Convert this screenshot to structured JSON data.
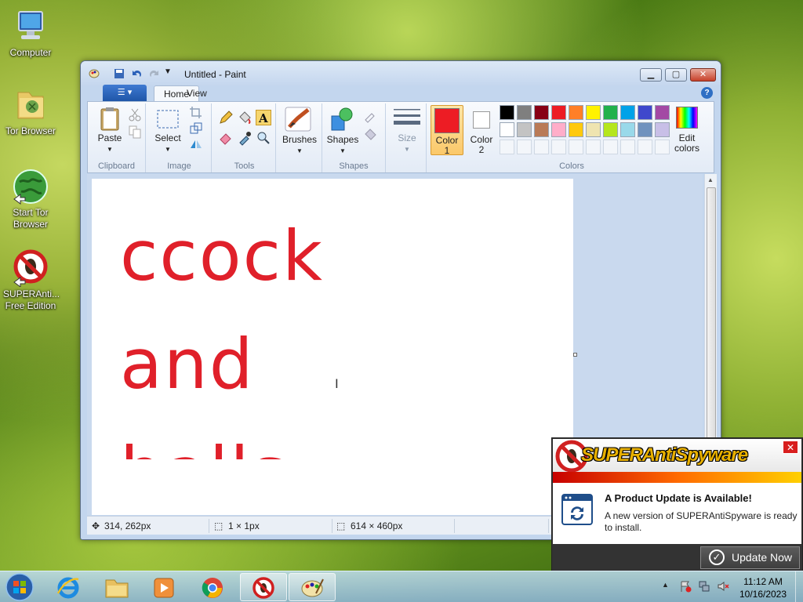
{
  "desktop": {
    "icons": [
      {
        "label": "Computer"
      },
      {
        "label": "Tor Browser"
      },
      {
        "label": "Start Tor Browser"
      },
      {
        "label": "SUPERAnti... Free Edition"
      }
    ]
  },
  "paint": {
    "title": "Untitled - Paint",
    "file_menu": "☰",
    "tabs": {
      "home": "Home",
      "view": "View"
    },
    "groups": {
      "clipboard": "Clipboard",
      "image": "Image",
      "tools": "Tools",
      "shapes": "Shapes",
      "colors": "Colors"
    },
    "buttons": {
      "paste": "Paste",
      "select": "Select",
      "brushes": "Brushes",
      "shapes": "Shapes",
      "size": "Size",
      "color1_line1": "Color",
      "color1_line2": "1",
      "color2_line1": "Color",
      "color2_line2": "2",
      "edit_colors_line1": "Edit",
      "edit_colors_line2": "colors"
    },
    "selected_colors": {
      "color1": "#ed1c24",
      "color2": "#ffffff"
    },
    "palette_row1": [
      "#000000",
      "#7f7f7f",
      "#880015",
      "#ed1c24",
      "#ff7f27",
      "#fff200",
      "#22b14c",
      "#00a2e8",
      "#3f48cc",
      "#a349a4"
    ],
    "palette_row2": [
      "#ffffff",
      "#c3c3c3",
      "#b97a57",
      "#ffaec9",
      "#ffc90e",
      "#efe4b0",
      "#b5e61d",
      "#99d9ea",
      "#7092be",
      "#c8bfe7"
    ],
    "canvas_words": [
      "ccock",
      "and",
      "balls"
    ],
    "status": {
      "cursor": "314, 262px",
      "selection": "1 × 1px",
      "image_size": "614 × 460px"
    }
  },
  "notification": {
    "brand": "SUPERAntiSpyware",
    "close_label": "✕",
    "heading": "A Product Update is Available!",
    "message": "A new version of SUPERAntiSpyware is ready to install.",
    "button_label": "Update Now"
  },
  "taskbar": {
    "time": "11:12 AM",
    "date": "10/16/2023",
    "show_hidden": "▲"
  }
}
